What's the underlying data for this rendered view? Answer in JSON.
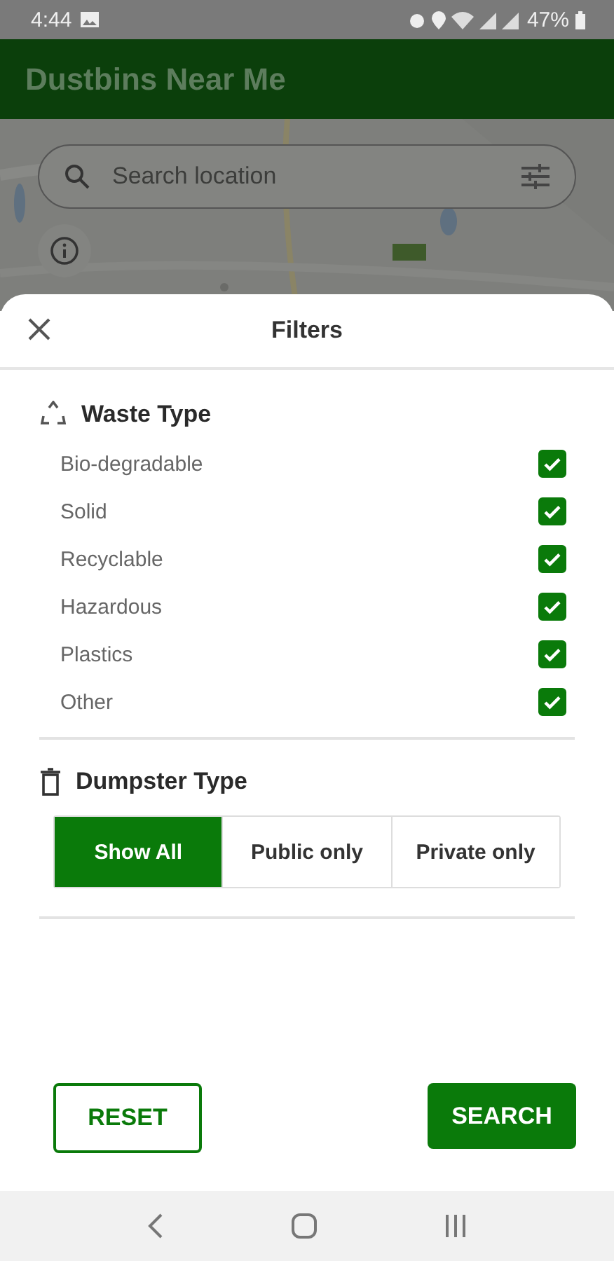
{
  "status_bar": {
    "time": "4:44",
    "battery": "47%"
  },
  "app_bar": {
    "title": "Dustbins Near Me"
  },
  "search": {
    "placeholder": "Search location"
  },
  "sheet": {
    "title": "Filters"
  },
  "waste_type": {
    "title": "Waste Type",
    "items": [
      {
        "label": "Bio-degradable",
        "checked": true
      },
      {
        "label": "Solid",
        "checked": true
      },
      {
        "label": "Recyclable",
        "checked": true
      },
      {
        "label": "Hazardous",
        "checked": true
      },
      {
        "label": "Plastics",
        "checked": true
      },
      {
        "label": "Other",
        "checked": true
      }
    ]
  },
  "dumpster_type": {
    "title": "Dumpster Type",
    "options": [
      {
        "label": "Show All",
        "selected": true
      },
      {
        "label": "Public only",
        "selected": false
      },
      {
        "label": "Private only",
        "selected": false
      }
    ]
  },
  "buttons": [
    {
      "label": "RESET",
      "kind": "outlined"
    },
    {
      "label": "SEARCH",
      "kind": "filled"
    }
  ]
}
